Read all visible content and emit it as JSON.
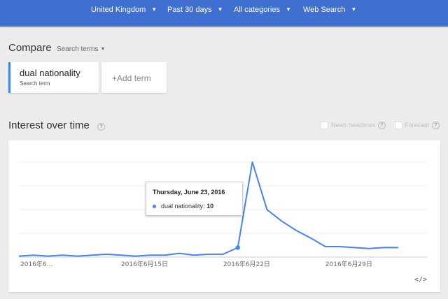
{
  "filters": {
    "region": "United Kingdom",
    "time": "Past 30 days",
    "category": "All categories",
    "search_type": "Web Search"
  },
  "compare": {
    "title": "Compare",
    "search_terms_label": "Search terms",
    "term": {
      "name": "dual nationality",
      "subtitle": "Search term"
    },
    "add_term_label": "+Add term"
  },
  "interest_over_time": {
    "title": "Interest over time",
    "news_headlines_label": "News headlines",
    "forecast_label": "Forecast",
    "help_glyph": "?"
  },
  "tooltip": {
    "date": "Thursday, June 23, 2016",
    "series_label": "dual nationality:",
    "value": "10"
  },
  "icons": {
    "filter_caret": "caret-down-icon",
    "help": "help-icon",
    "embed": "embed-code-icon",
    "embed_glyph": "</>"
  },
  "colors": {
    "topbar": "#3f6fd1",
    "series_line": "#4285f4",
    "term_accent": "#4285f4"
  },
  "chart_data": {
    "type": "line",
    "title": "",
    "xlabel": "",
    "ylabel": "",
    "ylim": [
      0,
      100
    ],
    "grid": true,
    "x_tick_labels": [
      "2016年6...",
      "2016年6月15日",
      "2016年6月22日",
      "2016年6月29日"
    ],
    "x": [
      "2016-06-08",
      "2016-06-09",
      "2016-06-10",
      "2016-06-11",
      "2016-06-12",
      "2016-06-13",
      "2016-06-14",
      "2016-06-15",
      "2016-06-16",
      "2016-06-17",
      "2016-06-18",
      "2016-06-19",
      "2016-06-20",
      "2016-06-21",
      "2016-06-22",
      "2016-06-23",
      "2016-06-24",
      "2016-06-25",
      "2016-06-26",
      "2016-06-27",
      "2016-06-28",
      "2016-06-29",
      "2016-06-30",
      "2016-07-01",
      "2016-07-02",
      "2016-07-03",
      "2016-07-04"
    ],
    "series": [
      {
        "name": "dual nationality",
        "values": [
          1,
          2,
          1,
          2,
          1,
          2,
          3,
          2,
          1,
          2,
          2,
          4,
          2,
          3,
          3,
          10,
          100,
          50,
          38,
          28,
          20,
          11,
          11,
          10,
          9,
          10,
          10
        ]
      }
    ],
    "highlight": {
      "x": "2016-06-23",
      "value": 10
    }
  }
}
